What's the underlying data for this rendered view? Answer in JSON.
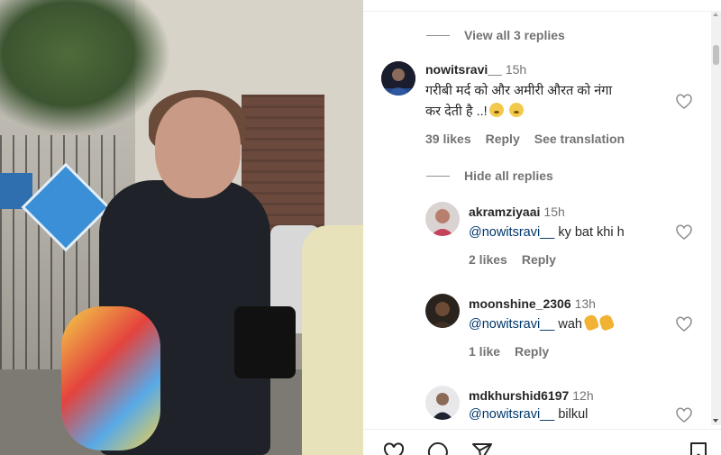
{
  "thread": {
    "view_replies_label": "View all 3 replies",
    "hide_replies_label": "Hide all replies"
  },
  "main_comment": {
    "username": "nowitsravi__",
    "time": "15h",
    "text_line1": "गरीबी मर्द को और अमीरी औरत को नंगा",
    "text_line2": "कर देती है ..!",
    "likes": "39 likes",
    "reply_label": "Reply",
    "translate_label": "See translation"
  },
  "replies": [
    {
      "username": "akramziyaai",
      "time": "15h",
      "mention": "@nowitsravi__",
      "text": "ky bat khi h",
      "likes": "2 likes",
      "reply_label": "Reply"
    },
    {
      "username": "moonshine_2306",
      "time": "13h",
      "mention": "@nowitsravi__",
      "text": "wah",
      "likes": "1 like",
      "reply_label": "Reply"
    },
    {
      "username": "mdkhurshid6197",
      "time": "12h",
      "mention": "@nowitsravi__",
      "text": "bilkul"
    }
  ],
  "colors": {
    "text_primary": "#262626",
    "text_secondary": "#737373",
    "mention": "#00376b"
  },
  "icons": {
    "like": "heart-icon",
    "comment": "comment-icon",
    "share": "share-icon",
    "save": "bookmark-icon"
  }
}
